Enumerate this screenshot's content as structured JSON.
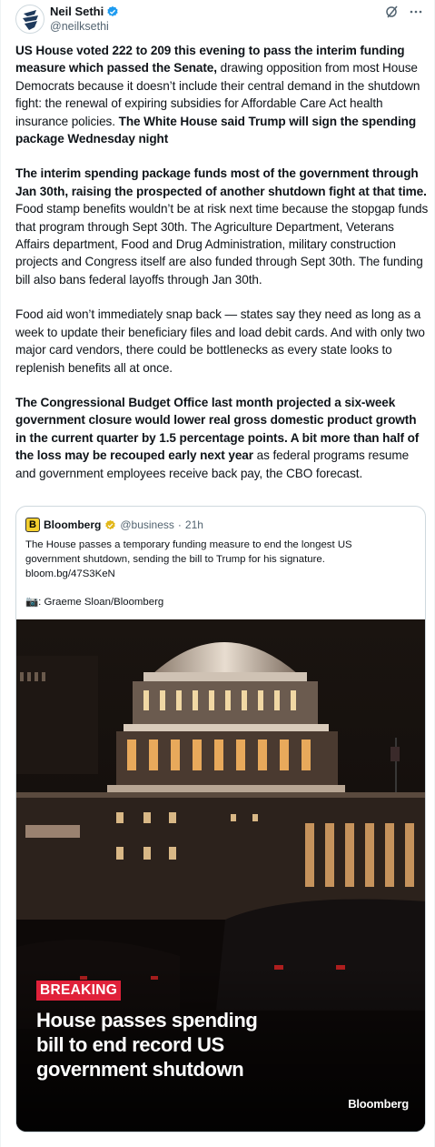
{
  "author": {
    "name": "Neil Sethi",
    "handle": "@neilksethi"
  },
  "icons": {
    "verified": "verified-badge-icon",
    "grok": "grok-icon",
    "more": "more-icon",
    "gold_badge": "gold-verified-badge-icon"
  },
  "colors": {
    "verified_blue": "#1d9bf0",
    "breaking_red": "#e0213a",
    "bloomberg_yellow": "#f4cf2e"
  },
  "tweet": {
    "p1_b1": "US House voted 222 to 209 this evening to pass the interim funding measure which passed the Senate,",
    "p1_t1": " drawing opposition from most House Democrats because it doesn’t include their central demand in the shutdown fight: the renewal of expiring subsidies for Affordable Care Act health insurance policies. ",
    "p1_b2": "The White House said Trump will sign the spending package Wednesday night",
    "p2_b1": "The interim spending package funds most of the government through Jan 30th, raising the prospected of another shutdown fight at that time.",
    "p2_t1": " Food stamp benefits wouldn’t be at risk next time because the stopgap funds that program through Sept 30th. The Agriculture Department, Veterans Affairs department, Food and Drug Administration, military construction projects and Congress itself are also funded through Sept 30th. The funding bill also bans federal layoffs through Jan 30th.",
    "p3_t1": "Food aid won’t immediately snap back — states say they need as long as a week to update their beneficiary files and load debit cards. And with only two major card vendors, there could be bottlenecks as every state looks to replenish benefits all at once.",
    "p4_b1": "The Congressional Budget Office last month projected a six-week government closure would lower real gross domestic product growth in the current quarter by 1.5 percentage points. A bit more than half of the loss may be recouped early next year",
    "p4_t1": " as federal programs resume and government employees receive back pay, the CBO forecast."
  },
  "quote": {
    "logo_letter": "B",
    "name": "Bloomberg",
    "handle": "@business",
    "dot": "·",
    "time": "21h",
    "text_line1": "The House passes a temporary funding measure to end the longest US",
    "text_line2": "government shutdown, sending the bill to Trump for his signature.",
    "link": "bloom.bg/47S3KeN",
    "credit": "📷: Graeme Sloan/Bloomberg",
    "media": {
      "breaking": "BREAKING",
      "headline_line1": "House passes spending",
      "headline_line2": "bill to end record US",
      "headline_line3": "government shutdown",
      "wordmark": "Bloomberg"
    }
  }
}
